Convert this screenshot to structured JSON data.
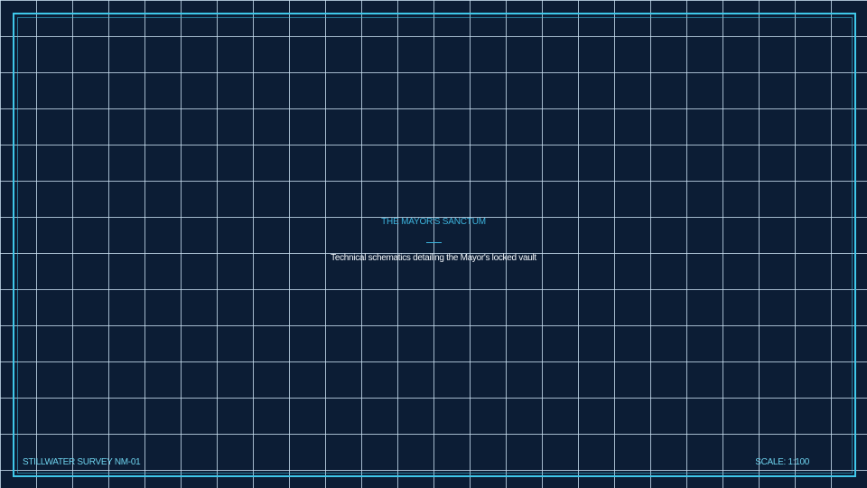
{
  "blueprint": {
    "title": "THE MAYOR'S SANCTUM",
    "subtitle": "Technical schematics detailing the Mayor's locked vault",
    "survey_id": "STILLWATER SURVEY NM-01",
    "scale": "SCALE: 1:100"
  },
  "colors": {
    "background": "#0c1d35",
    "grid_line": "#cde4f5",
    "frame": "#3fc8ea",
    "title": "#3cb3dc",
    "subtitle": "#f2f6fa",
    "footer_text": "#6ed3ee"
  }
}
